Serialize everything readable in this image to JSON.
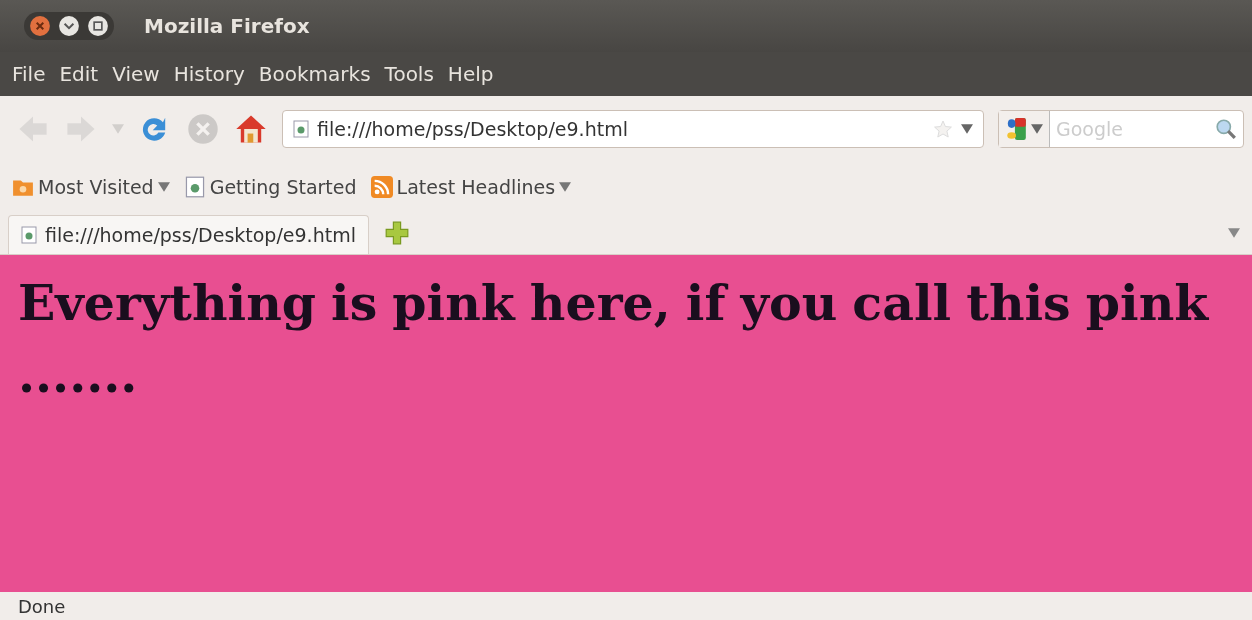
{
  "window": {
    "title": "Mozilla Firefox"
  },
  "menu": [
    "File",
    "Edit",
    "View",
    "History",
    "Bookmarks",
    "Tools",
    "Help"
  ],
  "nav_buttons": [
    {
      "kind": "back",
      "disabled": true
    },
    {
      "kind": "forward",
      "disabled": true
    },
    {
      "kind": "history",
      "disabled": true
    },
    {
      "kind": "reload",
      "disabled": false
    },
    {
      "kind": "stop",
      "disabled": true
    },
    {
      "kind": "home",
      "disabled": false
    }
  ],
  "address": {
    "value": "file:///home/pss/Desktop/e9.html"
  },
  "search": {
    "placeholder": "Google"
  },
  "bookmarks": [
    {
      "label": "Most Visited",
      "kind": "folder",
      "dropdown": true
    },
    {
      "label": "Getting Started",
      "kind": "page",
      "dropdown": false
    },
    {
      "label": "Latest Headlines",
      "kind": "feed",
      "dropdown": true
    }
  ],
  "tabs": [
    {
      "label": "file:///home/pss/Desktop/e9.html",
      "selected": true
    }
  ],
  "page": {
    "heading": "Everything is pink here, if you call this pink ......."
  },
  "status_bar": "Done"
}
